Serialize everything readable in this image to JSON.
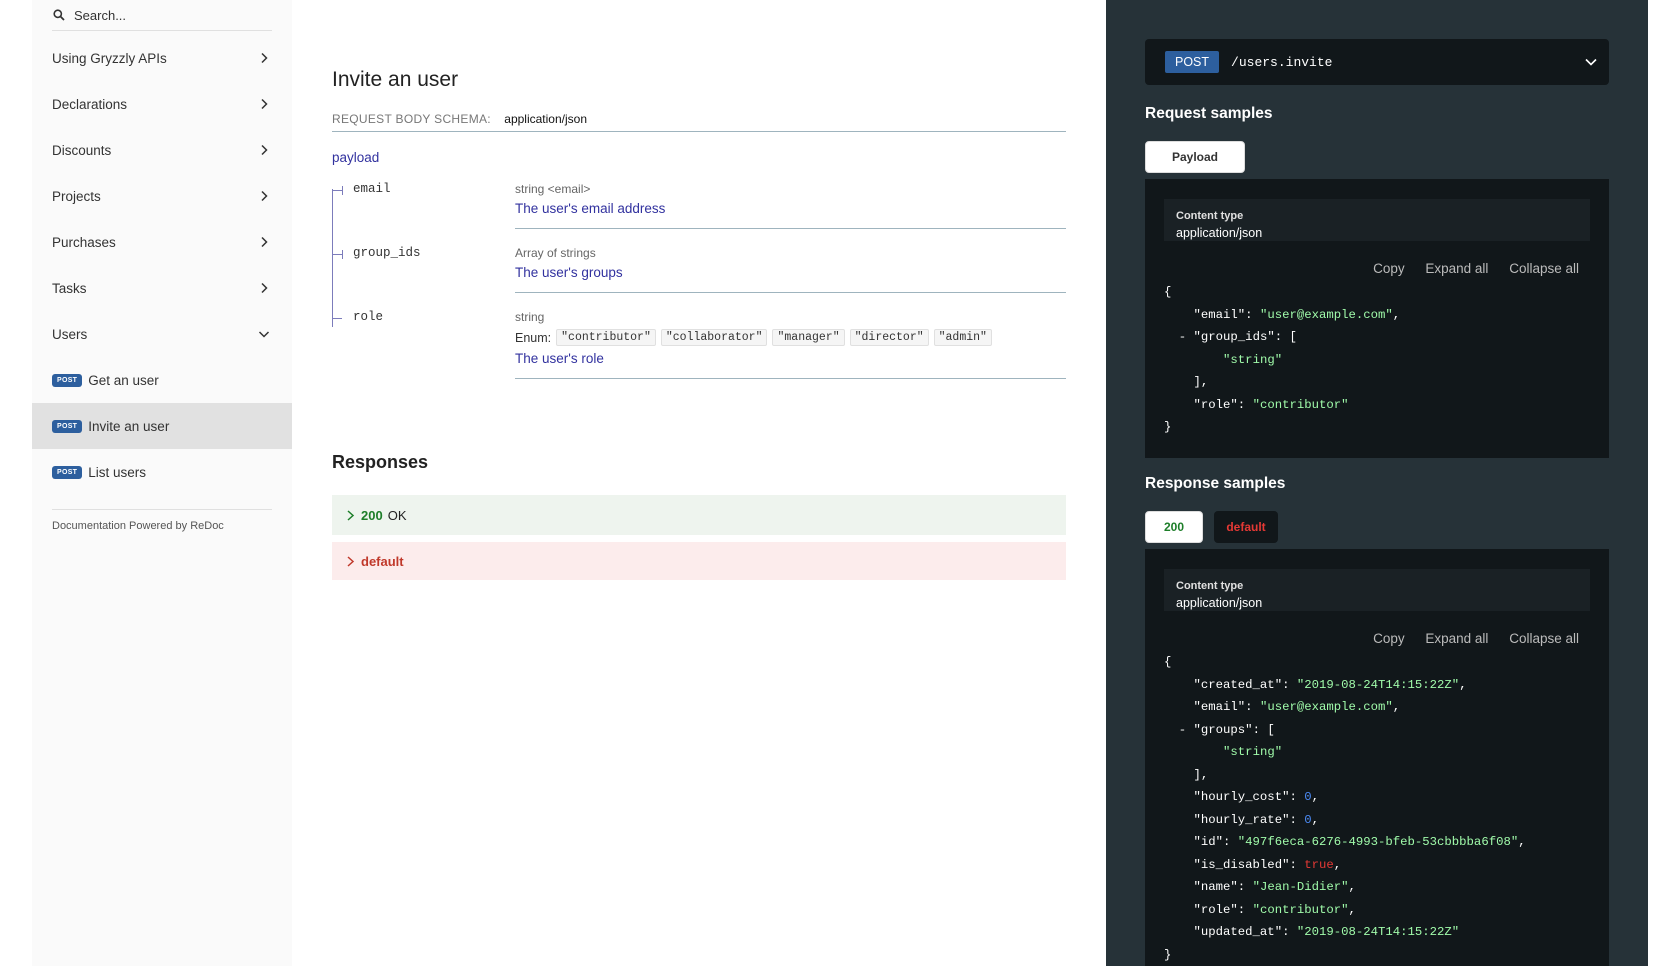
{
  "sidebar": {
    "search_placeholder": "Search...",
    "items": [
      {
        "label": "Using Gryzzly APIs"
      },
      {
        "label": "Declarations"
      },
      {
        "label": "Discounts"
      },
      {
        "label": "Projects"
      },
      {
        "label": "Purchases"
      },
      {
        "label": "Tasks"
      },
      {
        "label": "Users"
      }
    ],
    "sub_items": [
      {
        "badge": "POST",
        "label": "Get an user"
      },
      {
        "badge": "POST",
        "label": "Invite an user"
      },
      {
        "badge": "POST",
        "label": "List users"
      }
    ],
    "powered_by": "Documentation Powered by ReDoc"
  },
  "main": {
    "title": "Invite an user",
    "schema_label": "REQUEST BODY SCHEMA:",
    "schema_type": "application/json",
    "payload_label": "payload",
    "properties": [
      {
        "name": "email",
        "type": "string <email>",
        "description": "The user's email address"
      },
      {
        "name": "group_ids",
        "type": "Array of strings",
        "description": "The user's groups"
      },
      {
        "name": "role",
        "type": "string",
        "enum_label": "Enum:",
        "enum": [
          "\"contributor\"",
          "\"collaborator\"",
          "\"manager\"",
          "\"director\"",
          "\"admin\""
        ],
        "description": "The user's role"
      }
    ],
    "responses_title": "Responses",
    "responses": [
      {
        "code": "200",
        "text": "OK"
      },
      {
        "code": "default",
        "text": ""
      }
    ]
  },
  "right": {
    "method": "POST",
    "path": "/users.invite",
    "request_title": "Request samples",
    "request_tab": "Payload",
    "content_type_label": "Content type",
    "content_type_value": "application/json",
    "actions": [
      "Copy",
      "Expand all",
      "Collapse all"
    ],
    "response_title": "Response samples",
    "response_tabs": [
      "200",
      "default"
    ],
    "request_json": {
      "email": "\"user@example.com\"",
      "group_ids_item": "\"string\"",
      "role": "\"contributor\""
    },
    "response_json": {
      "created_at": "\"2019-08-24T14:15:22Z\"",
      "email": "\"user@example.com\"",
      "groups_item": "\"string\"",
      "hourly_cost": "0",
      "hourly_rate": "0",
      "id": "\"497f6eca-6276-4993-bfeb-53cbbbba6f08\"",
      "is_disabled": "true",
      "name": "\"Jean-Didier\"",
      "role": "\"contributor\"",
      "updated_at": "\"2019-08-24T14:15:22Z\""
    }
  },
  "colors": {
    "sidebar_bg": "#fafafa",
    "right_panel_bg": "#263238",
    "code_bg": "#11171a",
    "post_badge": "#2d5f9e",
    "link": "#32329f",
    "success": "#1d7e29",
    "error": "#e53935"
  }
}
